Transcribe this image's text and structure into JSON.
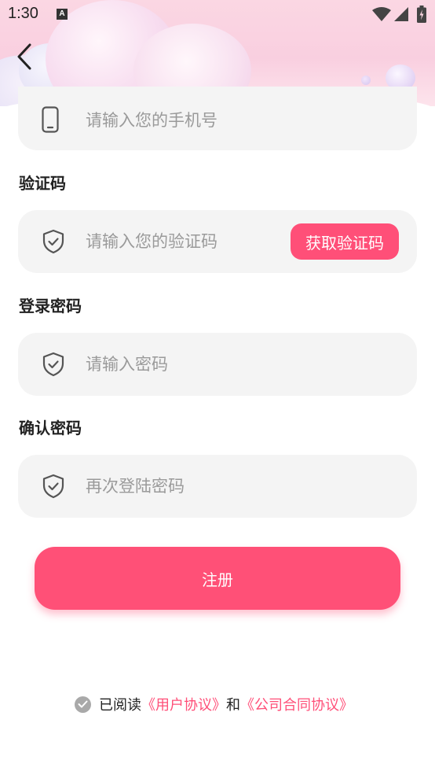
{
  "status_bar": {
    "time": "1:30",
    "notification": "A"
  },
  "form": {
    "phone": {
      "placeholder": "请输入您的手机号"
    },
    "code": {
      "label": "验证码",
      "placeholder": "请输入您的验证码",
      "button": "获取验证码"
    },
    "password": {
      "label": "登录密码",
      "placeholder": "请输入密码"
    },
    "confirm": {
      "label": "确认密码",
      "placeholder": "再次登陆密码"
    }
  },
  "submit_label": "注册",
  "agreement": {
    "prefix": "已阅读",
    "user_agreement": "《用户协议》",
    "and": "和",
    "company_agreement": "《公司合同协议》"
  },
  "colors": {
    "accent": "#ff4f78",
    "field_bg": "#f4f4f4",
    "header_pink": "#f9cfe0"
  },
  "icons": [
    "back-icon",
    "phone-icon",
    "shield-check-icon",
    "wifi-icon",
    "signal-icon",
    "battery-icon",
    "check-icon"
  ]
}
